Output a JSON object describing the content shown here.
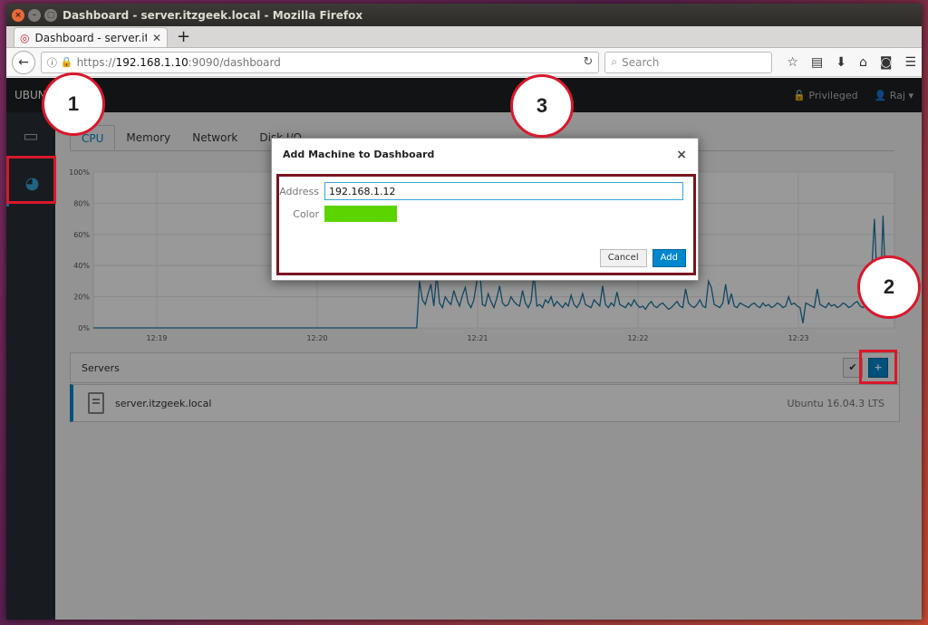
{
  "window": {
    "title": "Dashboard - server.itzgeek.local - Mozilla Firefox"
  },
  "browser": {
    "tab_title": "Dashboard - server.itzgeek.local",
    "url_prefix": "https://",
    "url_host": "192.168.1.10",
    "url_rest": ":9090/dashboard",
    "search_placeholder": "Search"
  },
  "cockpit": {
    "hostname": "UBUNTU",
    "privileged": "Privileged",
    "user": "Raj",
    "tabs": [
      "CPU",
      "Memory",
      "Network",
      "Disk I/O"
    ],
    "servers_label": "Servers",
    "server": {
      "name": "server.itzgeek.local",
      "os": "Ubuntu 16.04.3 LTS"
    }
  },
  "modal": {
    "title": "Add Machine to Dashboard",
    "address_label": "Address",
    "address_value": "192.168.1.12",
    "color_label": "Color",
    "color_value": "#5cd400",
    "cancel_label": "Cancel",
    "add_label": "Add"
  },
  "chart_data": {
    "type": "line",
    "ylabels": [
      "100%",
      "80%",
      "60%",
      "40%",
      "20%",
      "0%"
    ],
    "xlabels": [
      "12:19",
      "12:20",
      "12:21",
      "12:22",
      "12:23"
    ],
    "ylim": [
      0,
      100
    ],
    "series": [
      {
        "values": [
          0,
          0,
          0,
          0,
          0,
          0,
          0,
          0,
          0,
          0,
          0,
          0,
          0,
          0,
          0,
          0,
          0,
          0,
          0,
          0,
          0,
          0,
          0,
          0,
          0,
          0,
          0,
          0,
          0,
          0,
          0,
          0,
          0,
          0,
          0,
          0,
          0,
          0,
          0,
          0,
          0,
          0,
          0,
          0,
          0,
          0,
          0,
          0,
          0,
          0,
          0,
          0,
          0,
          0,
          0,
          0,
          0,
          0,
          0,
          0,
          0,
          0,
          0,
          0,
          0,
          0,
          0,
          0,
          0,
          0,
          0,
          0,
          0,
          0,
          0,
          0,
          0,
          0,
          0,
          0,
          0,
          0,
          0,
          0,
          0,
          0,
          0,
          0,
          0,
          0,
          0,
          0,
          0,
          0,
          0,
          0,
          0,
          0,
          0,
          0,
          0,
          0,
          0,
          0,
          0,
          0,
          0,
          0,
          0,
          0,
          0,
          0,
          0,
          0,
          30,
          18,
          15,
          22,
          28,
          14,
          35,
          16,
          13,
          20,
          17,
          15,
          24,
          18,
          14,
          21,
          26,
          16,
          13,
          18,
          30,
          38,
          15,
          14,
          22,
          17,
          13,
          19,
          27,
          16,
          14,
          15,
          20,
          17,
          15,
          14,
          24,
          16,
          13,
          17,
          35,
          14,
          15,
          13,
          18,
          16,
          20,
          14,
          17,
          15,
          13,
          16,
          14,
          21,
          15,
          13,
          16,
          22,
          15,
          14,
          13,
          18,
          16,
          14,
          27,
          15,
          13,
          16,
          14,
          23,
          15,
          14,
          13,
          16,
          14,
          18,
          15,
          13,
          14,
          12,
          15,
          17,
          14,
          13,
          15,
          16,
          14,
          12,
          13,
          15,
          17,
          14,
          13,
          25,
          16,
          14,
          13,
          15,
          18,
          14,
          13,
          30,
          26,
          15,
          14,
          13,
          16,
          28,
          15,
          22,
          14,
          13,
          16,
          15,
          14,
          13,
          15,
          16,
          14,
          13,
          16,
          14,
          15,
          13,
          14,
          16,
          15,
          13,
          14,
          20,
          15,
          16,
          14,
          13,
          3,
          16,
          15,
          14,
          13,
          25,
          15,
          14,
          13,
          16,
          14,
          15,
          13,
          14,
          16,
          15,
          13,
          14,
          16,
          17,
          14,
          13,
          15,
          25,
          35,
          70,
          25,
          18,
          72,
          22,
          15,
          20,
          16
        ]
      }
    ]
  }
}
